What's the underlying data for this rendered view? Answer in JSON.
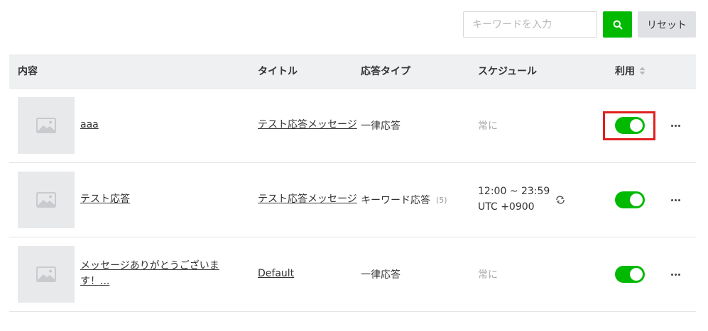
{
  "toolbar": {
    "search_placeholder": "キーワードを入力",
    "reset_label": "リセット"
  },
  "table": {
    "headers": {
      "content": "内容",
      "title": "タイトル",
      "response_type": "応答タイプ",
      "schedule": "スケジュール",
      "usage": "利用"
    },
    "rows": [
      {
        "content": "aaa",
        "title": "テスト応答メッセージ",
        "response_type": "一律応答",
        "schedule": "常に",
        "enabled": true,
        "highlighted": true
      },
      {
        "content": "テスト応答",
        "title": "テスト応答メッセージ",
        "response_type": "キーワード応答",
        "keyword_count": "(5)",
        "schedule": "12:00 ~ 23:59",
        "schedule_tz": "UTC +0900",
        "repeat": true,
        "enabled": true
      },
      {
        "content": "メッセージありがとうございます！...",
        "title": "Default",
        "response_type": "一律応答",
        "schedule": "常に",
        "enabled": true
      }
    ]
  },
  "colors": {
    "accent": "#00b900",
    "highlight": "#e02020"
  }
}
